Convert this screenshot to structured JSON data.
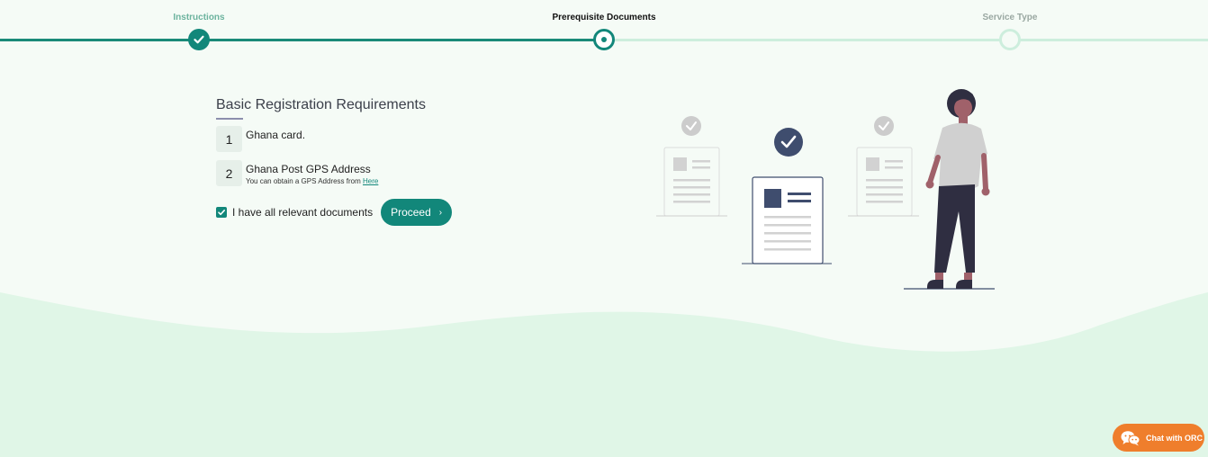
{
  "stepper": {
    "steps": [
      {
        "label": "Instructions",
        "state": "done"
      },
      {
        "label": "Prerequisite Documents",
        "state": "active"
      },
      {
        "label": "Service Type",
        "state": "todo"
      }
    ]
  },
  "requirements": {
    "title": "Basic Registration Requirements",
    "items": [
      {
        "number": "1",
        "name": "Ghana card."
      },
      {
        "number": "2",
        "name": "Ghana Post GPS Address",
        "note": "You can obtain a GPS Address from",
        "link": "Here"
      }
    ],
    "acknowledge_label": "I have all relevant documents",
    "acknowledge_checked": true,
    "proceed_label": "Proceed"
  },
  "chat": {
    "label": "Chat with ORC",
    "icon": "chat-bubbles-icon"
  },
  "colors": {
    "primary": "#12877a",
    "background": "#f5fbf6",
    "wave": "#e0f6e7",
    "chat": "#ef7e2c",
    "illustration_accent": "#3f4d6e"
  }
}
